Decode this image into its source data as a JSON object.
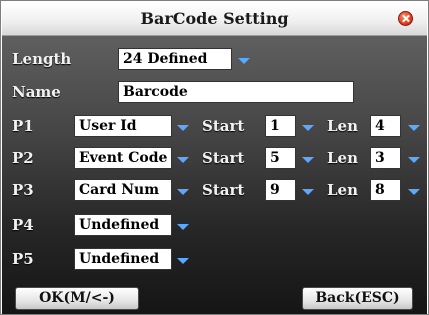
{
  "window": {
    "title": "BarCode Setting"
  },
  "length": {
    "label": "Length",
    "value": "24 Defined"
  },
  "name": {
    "label": "Name",
    "value": "Barcode"
  },
  "parts": [
    {
      "label": "P1",
      "field": "User Id",
      "start_label": "Start",
      "start": "1",
      "len_label": "Len",
      "len": "4"
    },
    {
      "label": "P2",
      "field": "Event Code",
      "start_label": "Start",
      "start": "5",
      "len_label": "Len",
      "len": "3"
    },
    {
      "label": "P3",
      "field": "Card Num",
      "start_label": "Start",
      "start": "9",
      "len_label": "Len",
      "len": "8"
    },
    {
      "label": "P4",
      "field": "Undefined"
    },
    {
      "label": "P5",
      "field": "Undefined"
    }
  ],
  "buttons": {
    "ok": "OK(M/<-)",
    "back": "Back(ESC)"
  },
  "icons": {
    "close": "close-icon",
    "dropdown": "dropdown-arrow-icon"
  },
  "colors": {
    "dropdown_arrow": "#5aa8ff",
    "close": "#e0401e"
  }
}
